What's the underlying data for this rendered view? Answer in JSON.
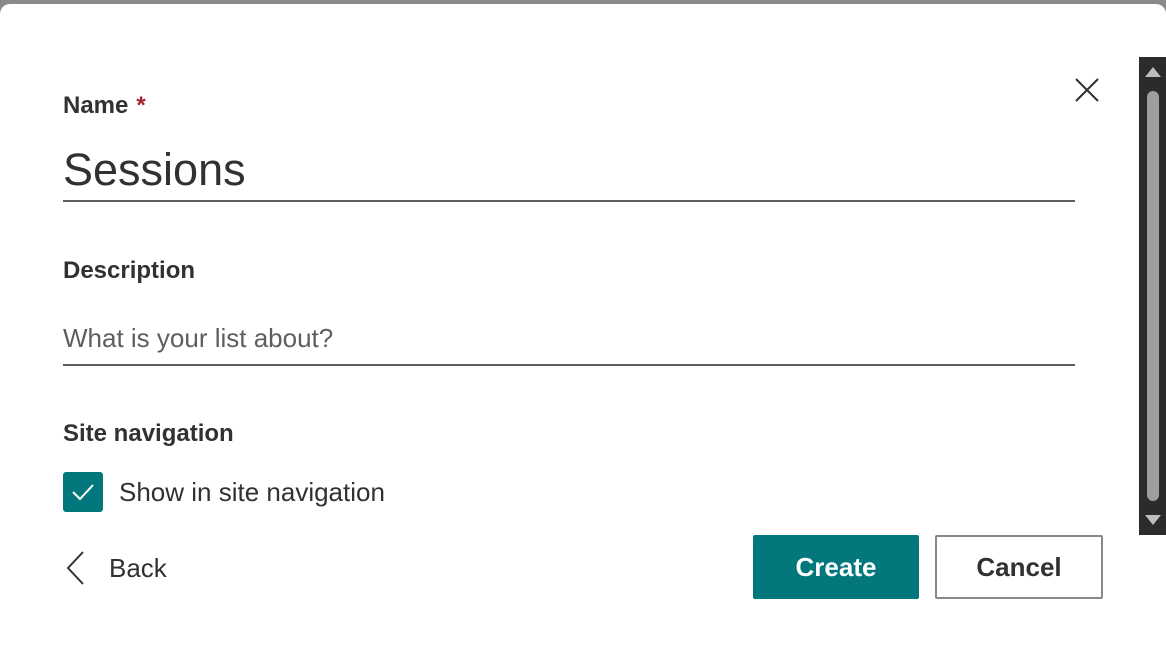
{
  "dialog": {
    "close_icon": "close-icon"
  },
  "name_field": {
    "label": "Name",
    "required_marker": "*",
    "value": "Sessions"
  },
  "description_field": {
    "label": "Description",
    "value": "",
    "placeholder": "What is your list about?"
  },
  "site_navigation": {
    "label": "Site navigation",
    "checkbox_label": "Show in site navigation",
    "checked": true
  },
  "footer": {
    "back_label": "Back",
    "create_label": "Create",
    "cancel_label": "Cancel"
  },
  "colors": {
    "accent": "#03787c",
    "required": "#a4262c",
    "text": "#323130"
  }
}
